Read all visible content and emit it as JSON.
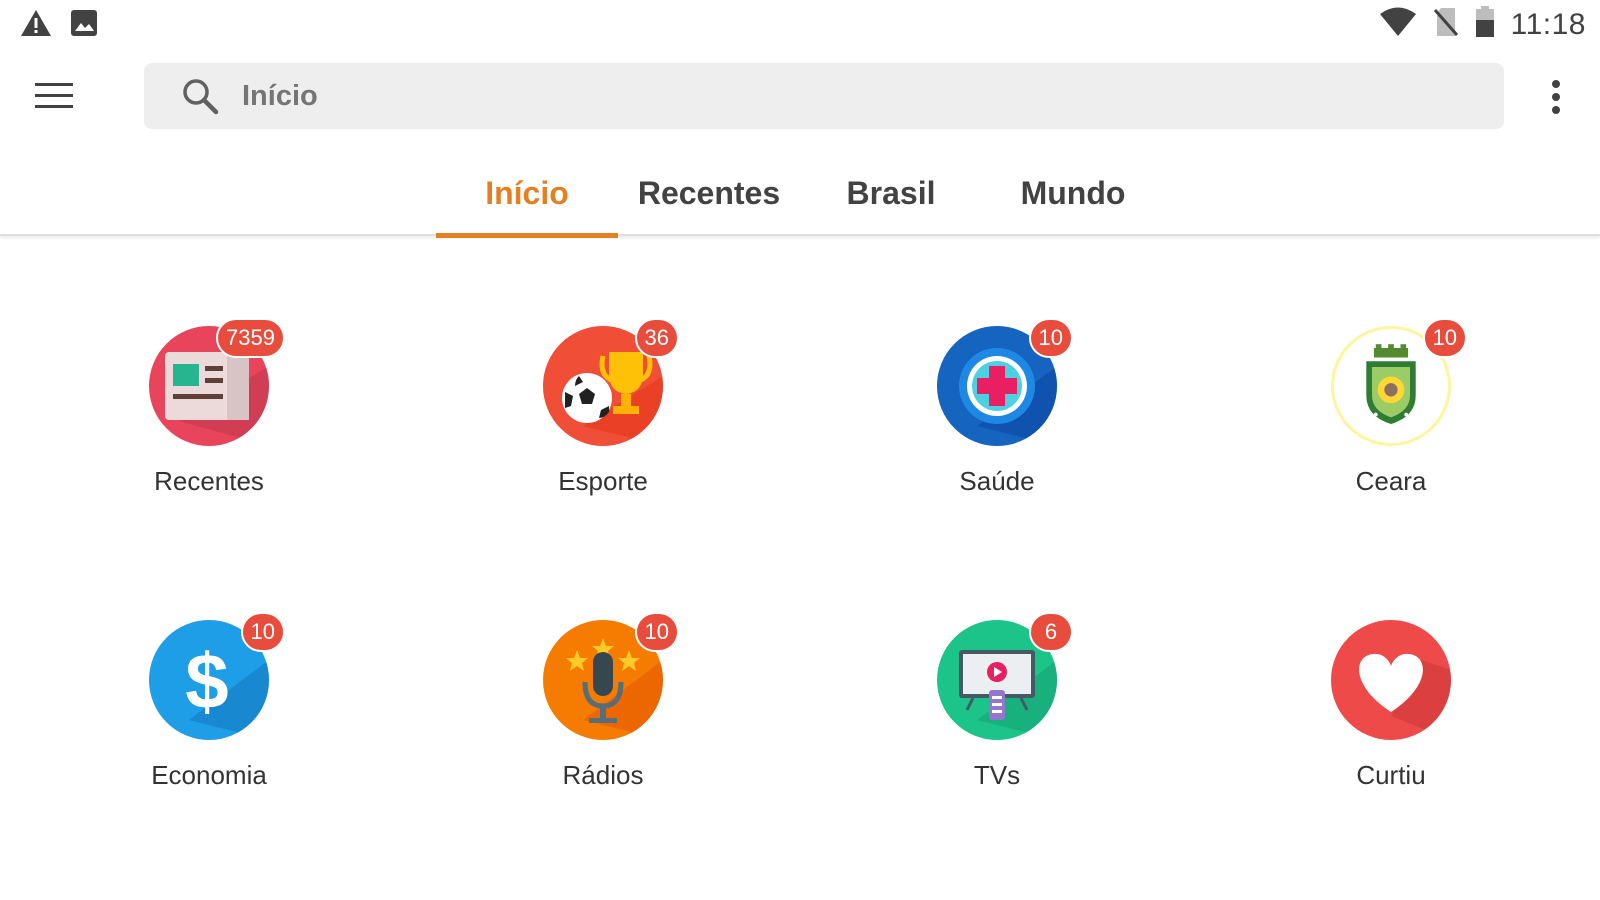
{
  "status_bar": {
    "time": "11:18",
    "left_icons": [
      "warning-icon",
      "image-icon"
    ],
    "right_icons": [
      "wifi-icon",
      "no-sim-icon",
      "battery-icon"
    ]
  },
  "app_bar": {
    "search_placeholder": "Início"
  },
  "tabs": [
    {
      "label": "Início",
      "active": true
    },
    {
      "label": "Recentes",
      "active": false
    },
    {
      "label": "Brasil",
      "active": false
    },
    {
      "label": "Mundo",
      "active": false
    }
  ],
  "categories": [
    {
      "label": "Recentes",
      "badge": "7359",
      "icon": "newspaper-icon",
      "color": "#e8455c"
    },
    {
      "label": "Esporte",
      "badge": "36",
      "icon": "trophy-ball-icon",
      "color": "#f04e37"
    },
    {
      "label": "Saúde",
      "badge": "10",
      "icon": "medical-cross-icon",
      "color": "#1565c0"
    },
    {
      "label": "Ceara",
      "badge": "10",
      "icon": "ceara-crest-icon",
      "color": "#fff59d"
    },
    {
      "label": "Economia",
      "badge": "10",
      "icon": "dollar-icon",
      "color": "#1e9ee6"
    },
    {
      "label": "Rádios",
      "badge": "10",
      "icon": "microphone-icon",
      "color": "#f57c00"
    },
    {
      "label": "TVs",
      "badge": "6",
      "icon": "tv-icon",
      "color": "#1dc48a"
    },
    {
      "label": "Curtiu",
      "badge": "",
      "icon": "heart-icon",
      "color": "#ef4a4a"
    }
  ],
  "colors": {
    "accent": "#e67e22",
    "badge": "#e74c3c"
  }
}
